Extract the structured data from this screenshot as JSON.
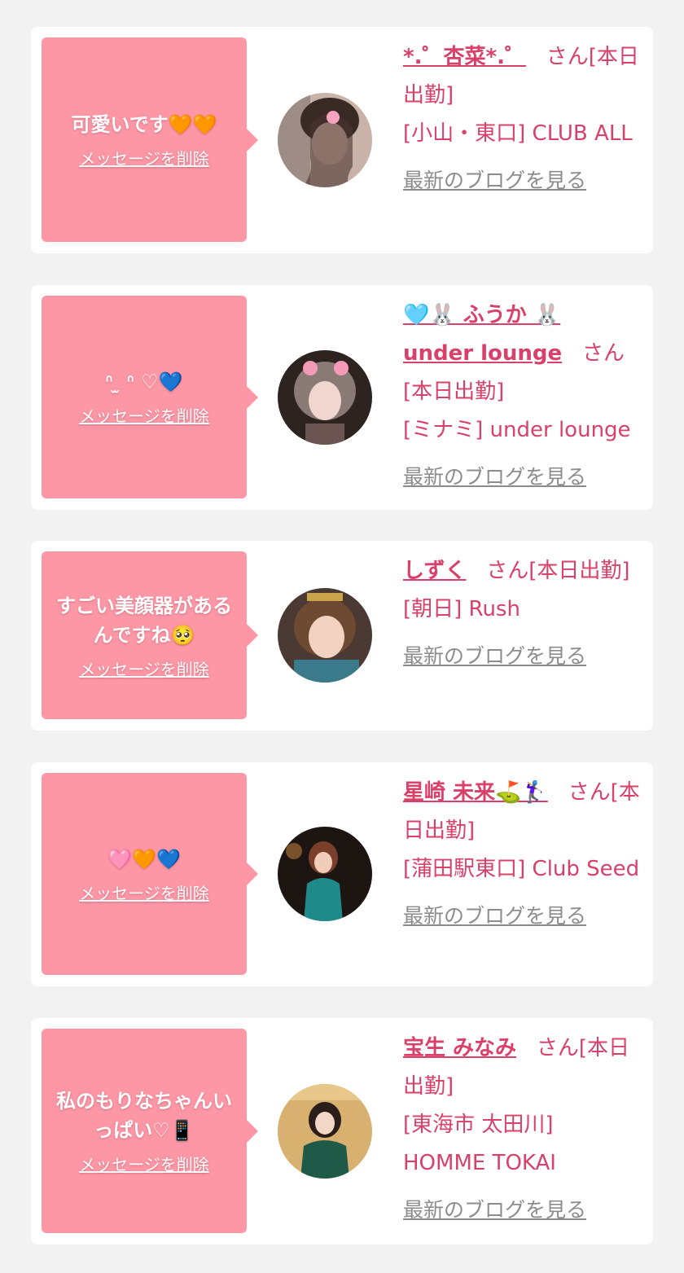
{
  "cards": [
    {
      "message": "可愛いです🧡🧡",
      "delete_label": "メッセージを削除",
      "name": "*.゜杏菜*.゜",
      "suffix": "さん[本日出勤]",
      "location": "[小山・東口] CLUB ALL",
      "blog_label": "最新のブログを見る"
    },
    {
      "message": "ᐢ ̫ ᐢ ♡💙",
      "delete_label": "メッセージを削除",
      "name": "🩵🐰 ふうか 🐰",
      "name2": "under lounge",
      "suffix": "さん[本日出勤]",
      "location": "[ミナミ] under lounge",
      "blog_label": "最新のブログを見る"
    },
    {
      "message": "すごい美顔器があるんですね🥺",
      "delete_label": "メッセージを削除",
      "name": "しずく",
      "suffix": "さん[本日出勤]",
      "location": "[朝日] Rush",
      "blog_label": "最新のブログを見る"
    },
    {
      "message": "🩷🧡💙",
      "delete_label": "メッセージを削除",
      "name": "星崎 未来⛳️🏌️‍♀️",
      "suffix": "さん[本日出勤]",
      "location": "[蒲田駅東口] Club Seed",
      "blog_label": "最新のブログを見る"
    },
    {
      "message": "私のもりなちゃんいっぱい♡📱",
      "delete_label": "メッセージを削除",
      "name": "宝生 みなみ",
      "suffix": "さん[本日出勤]",
      "location": "[東海市 太田川] HOMME TOKAI",
      "blog_label": "最新のブログを見る"
    }
  ]
}
